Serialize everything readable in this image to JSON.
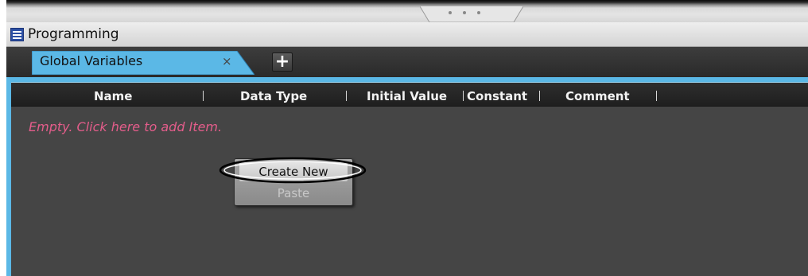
{
  "window": {
    "title": "Programming"
  },
  "tabs": [
    {
      "label": "Global Variables",
      "close_glyph": "×",
      "active": true
    }
  ],
  "tab_strip": {
    "add_glyph": "+"
  },
  "table": {
    "columns": [
      "Name",
      "Data Type",
      "Initial Value",
      "Constant",
      "Comment"
    ],
    "empty_message": "Empty. Click here to add Item."
  },
  "context_menu": {
    "items": [
      {
        "label": "Create New",
        "enabled": true,
        "highlighted": true
      },
      {
        "label": "Paste",
        "enabled": false
      }
    ]
  },
  "icons": {
    "window": "programming-window-icon",
    "tab_close": "close-icon",
    "add_tab": "plus-icon"
  },
  "colors": {
    "tab_active": "#5bb8e6",
    "empty_text": "#e45d8b",
    "content_background": "#454545",
    "header_background": "#262626"
  }
}
